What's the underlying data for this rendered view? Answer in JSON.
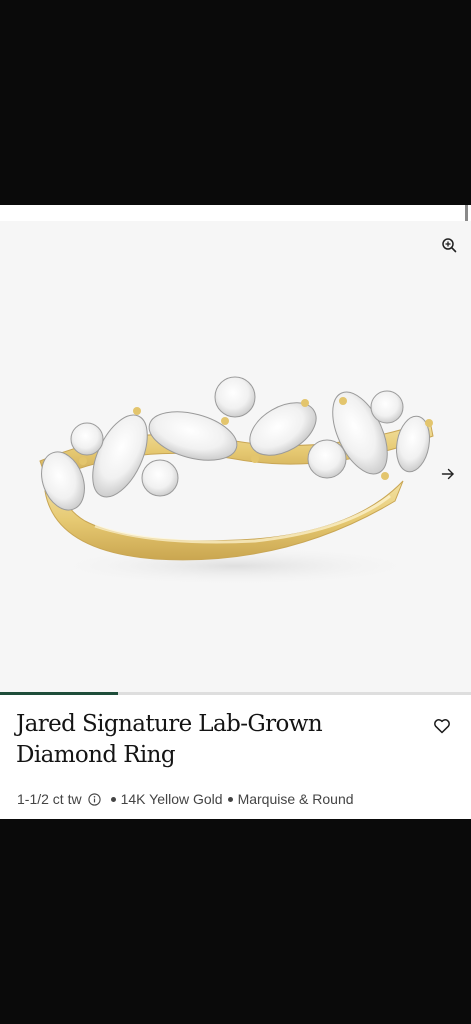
{
  "product": {
    "title_line1": "Jared Signature Lab-Grown",
    "title_line2": "Diamond Ring",
    "carat": "1-1/2 ct tw",
    "metal": "14K Yellow Gold",
    "shape": "Marquise & Round"
  },
  "gallery": {
    "image_subject": "ring-photo",
    "progress": 0.25
  },
  "icons": {
    "zoom": "zoom-in-icon",
    "next": "arrow-right-icon",
    "favorite": "heart-icon",
    "info": "info-icon"
  },
  "colors": {
    "accent": "#1e4d3a",
    "gold": "#e8cf7f"
  }
}
